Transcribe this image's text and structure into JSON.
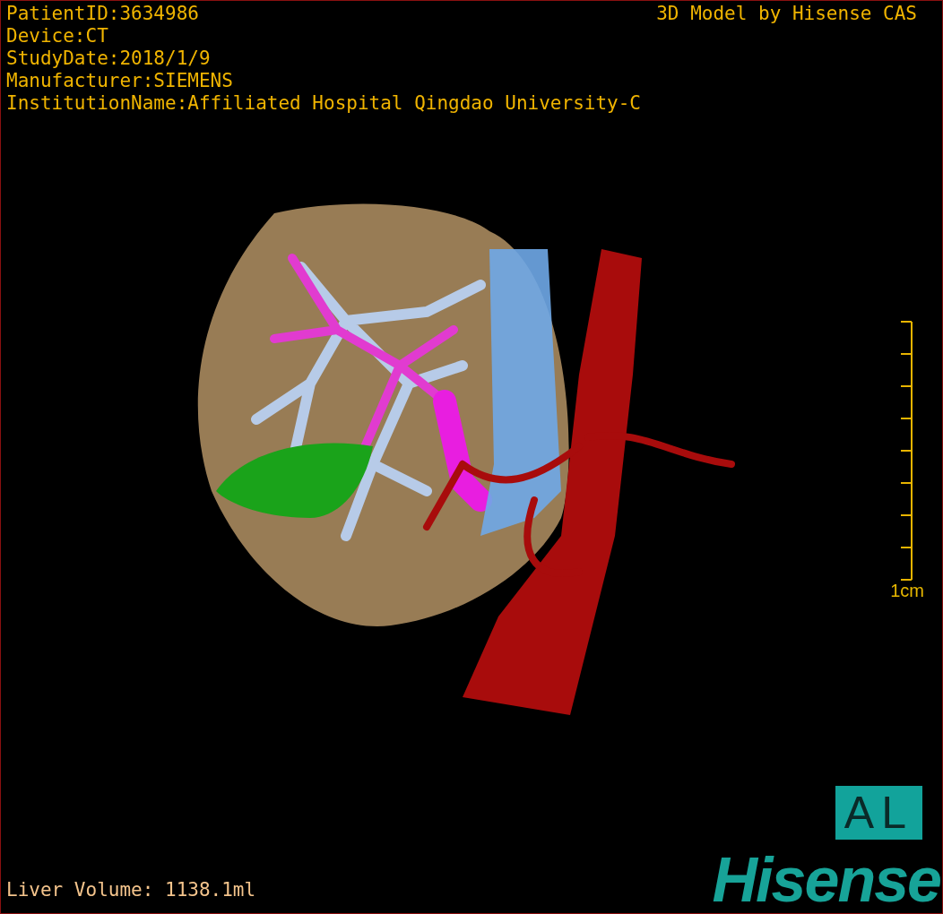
{
  "info_lines": [
    "PatientID:3634986",
    "Device:CT",
    "StudyDate:2018/1/9",
    "Manufacturer:SIEMENS",
    "InstitutionName:Affiliated Hospital Qingdao University-C"
  ],
  "credit": "3D Model by Hisense CAS",
  "scale": {
    "label": "1cm"
  },
  "volume": "Liver Volume: 1138.1ml",
  "orientation": "AL",
  "logo": "Hisense"
}
